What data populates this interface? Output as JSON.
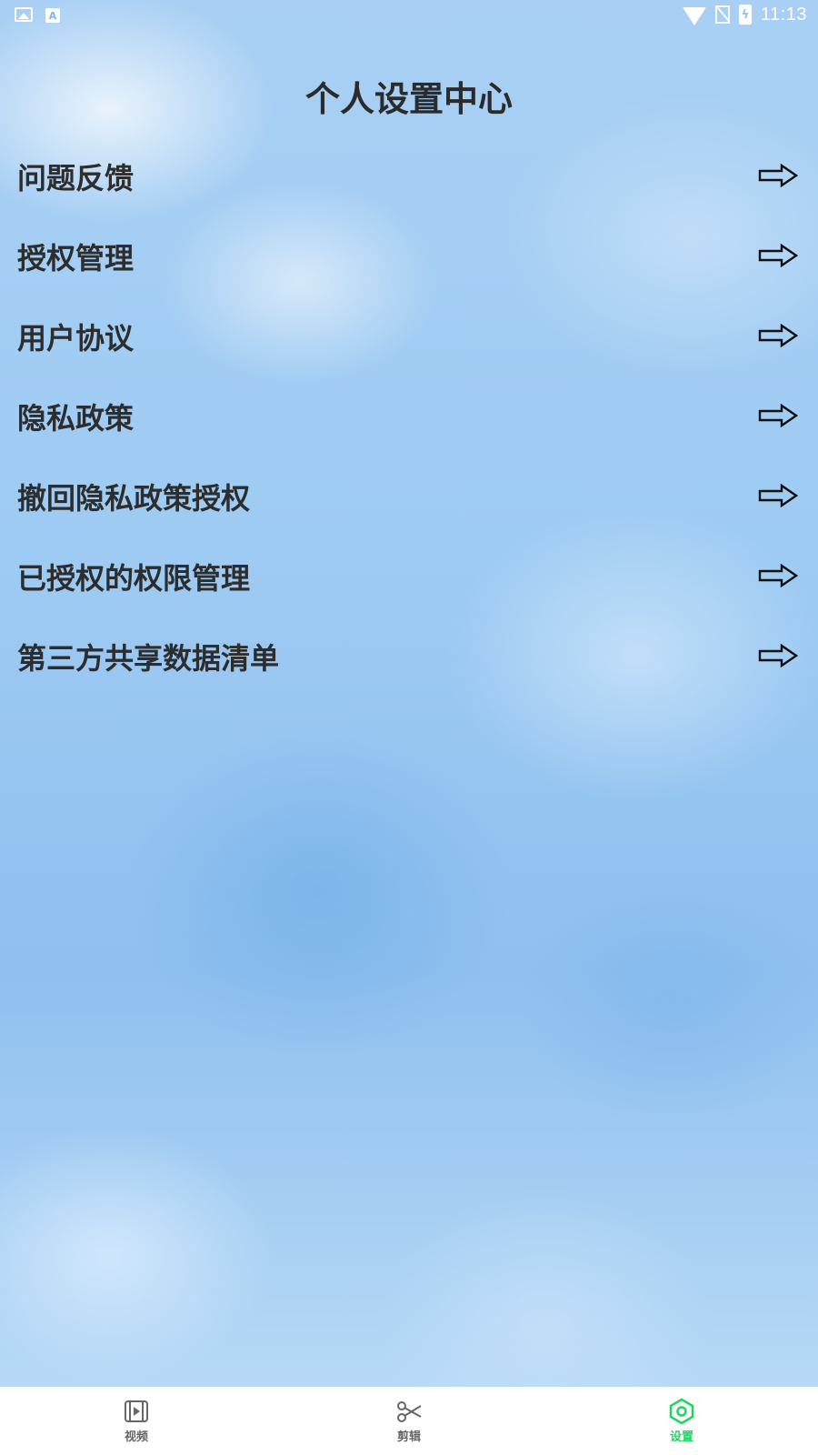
{
  "status_bar": {
    "time": "11:13",
    "left_icons": [
      "image-notification-icon",
      "a-notification-icon"
    ],
    "right_icons": [
      "wifi-icon",
      "no-sim-icon",
      "battery-charging-icon"
    ]
  },
  "page": {
    "title": "个人设置中心"
  },
  "menu": {
    "arrow_icon": "right-arrow-icon",
    "items": [
      {
        "label": "问题反馈"
      },
      {
        "label": "授权管理"
      },
      {
        "label": "用户协议"
      },
      {
        "label": "隐私政策"
      },
      {
        "label": "撤回隐私政策授权"
      },
      {
        "label": "已授权的权限管理"
      },
      {
        "label": "第三方共享数据清单"
      }
    ]
  },
  "bottom_nav": {
    "tabs": [
      {
        "label": "视频",
        "icon": "film-icon",
        "active": false
      },
      {
        "label": "剪辑",
        "icon": "scissors-icon",
        "active": false
      },
      {
        "label": "设置",
        "icon": "settings-hexagon-icon",
        "active": true
      }
    ]
  },
  "colors": {
    "active_tab": "#1ed760",
    "inactive_tab": "#666666",
    "text": "#2d2d2d",
    "background": "#9cc8f2"
  }
}
